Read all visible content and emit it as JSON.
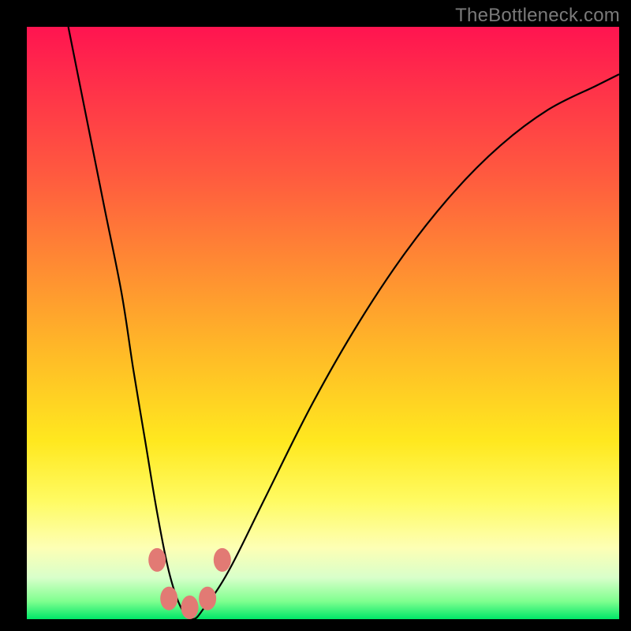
{
  "watermark": "TheBottleneck.com",
  "colors": {
    "page_bg": "#000000",
    "curve_stroke": "#000000",
    "marker_fill": "#e27a74",
    "marker_stroke": "#d96a63"
  },
  "chart_data": {
    "type": "line",
    "title": "",
    "xlabel": "",
    "ylabel": "",
    "xlim": [
      0,
      100
    ],
    "ylim": [
      0,
      100
    ],
    "grid": false,
    "legend": false,
    "background_gradient": {
      "direction": "vertical",
      "stops": [
        {
          "pos": 0.0,
          "color": "#ff1450"
        },
        {
          "pos": 0.25,
          "color": "#ff5a3f"
        },
        {
          "pos": 0.55,
          "color": "#ffba27"
        },
        {
          "pos": 0.8,
          "color": "#fffb62"
        },
        {
          "pos": 0.93,
          "color": "#d8ffca"
        },
        {
          "pos": 1.0,
          "color": "#00e768"
        }
      ]
    },
    "series": [
      {
        "name": "bottleneck-curve",
        "x": [
          7,
          10,
          13,
          16,
          18,
          20,
          22,
          24,
          26,
          28,
          30,
          34,
          40,
          48,
          56,
          64,
          72,
          80,
          88,
          96,
          100
        ],
        "y": [
          100,
          85,
          70,
          55,
          42,
          30,
          18,
          8,
          2,
          0,
          2,
          8,
          20,
          36,
          50,
          62,
          72,
          80,
          86,
          90,
          92
        ]
      }
    ],
    "markers": [
      {
        "x": 22.0,
        "y": 10.0
      },
      {
        "x": 24.0,
        "y": 3.5
      },
      {
        "x": 27.5,
        "y": 2.0
      },
      {
        "x": 30.5,
        "y": 3.5
      },
      {
        "x": 33.0,
        "y": 10.0
      }
    ],
    "minimum": {
      "x": 27.5,
      "y": 0
    }
  }
}
